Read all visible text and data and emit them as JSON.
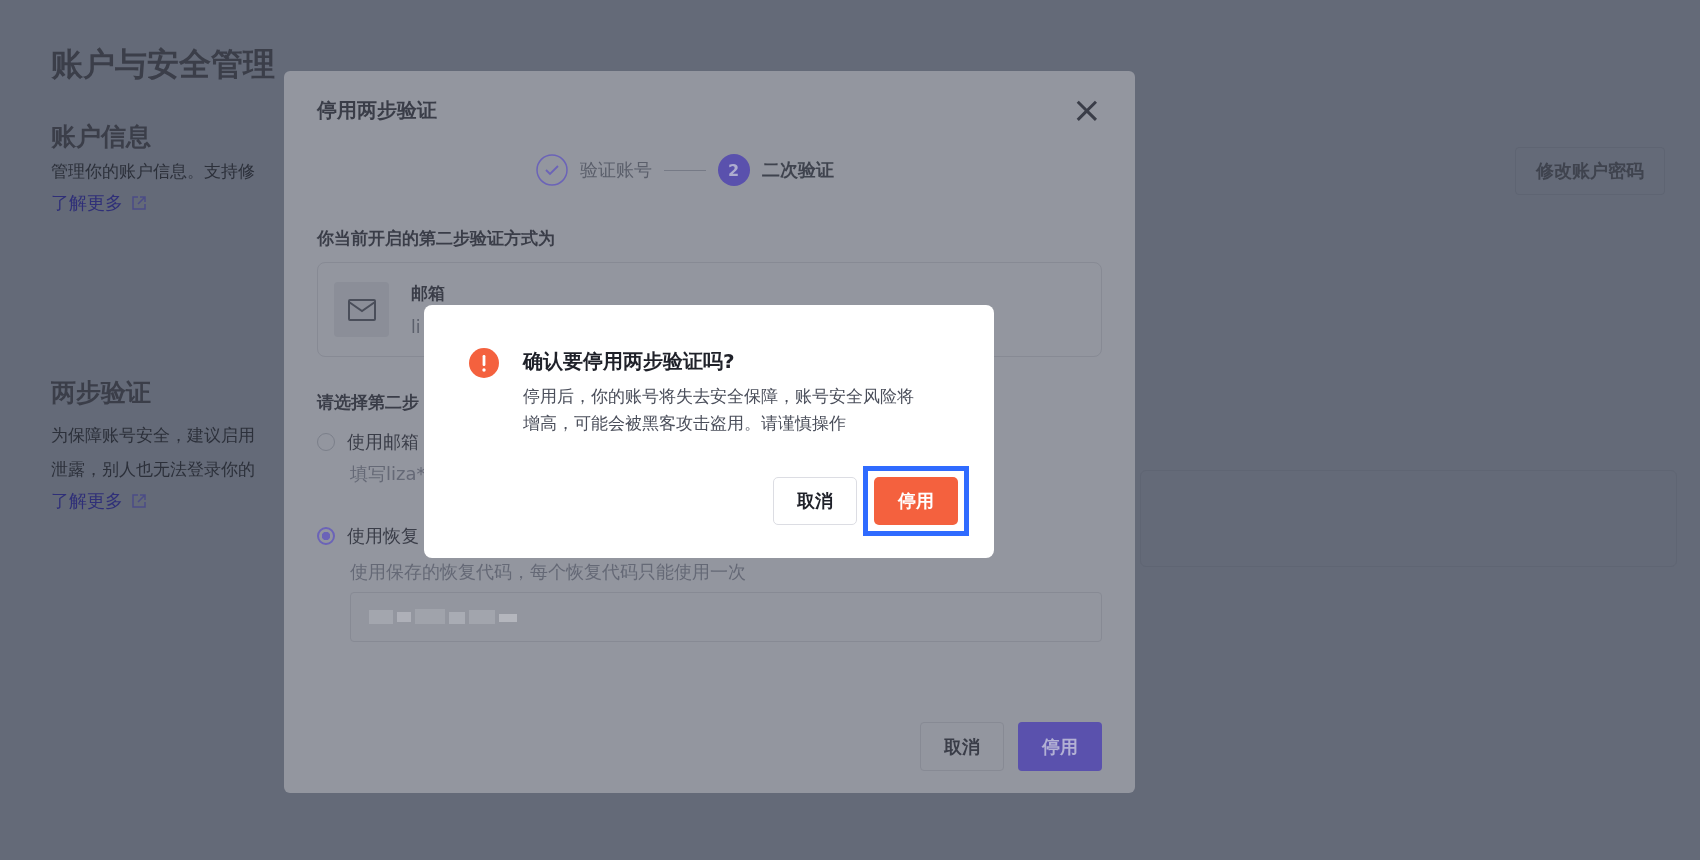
{
  "page": {
    "title": "账户与安全管理",
    "sections": [
      {
        "title": "账户信息",
        "lines": [
          "管理你的账户信息。支持修"
        ],
        "link": "了解更多",
        "action": "修改账户密码"
      },
      {
        "title": "两步验证",
        "lines": [
          "为保障账号安全，建议启用",
          "泄露，别人也无法登录你的"
        ],
        "link": "了解更多"
      }
    ]
  },
  "modal": {
    "title": "停用两步验证",
    "close": "×",
    "steps": [
      {
        "label": "验证账号",
        "completed": true
      },
      {
        "label": "二次验证",
        "completed": false,
        "number": "2"
      }
    ],
    "current_label": "你当前开启的第二步验证方式为",
    "method": {
      "name": "邮箱",
      "value": "li"
    },
    "choose_label": "请选择第二步",
    "options": [
      {
        "label": "使用邮箱",
        "hint": "填写liza*",
        "selected": false
      },
      {
        "label": "使用恢复",
        "hint": "使用保存的恢复代码，每个恢复代码只能使用一次",
        "selected": true,
        "code_redacted": true
      }
    ],
    "buttons": [
      {
        "label": "取消",
        "kind": "secondary"
      },
      {
        "label": "停用",
        "kind": "primary"
      }
    ]
  },
  "confirm": {
    "title": "确认要停用两步验证吗?",
    "message": "停用后，你的账号将失去安全保障，账号安全风险将增高，可能会被黑客攻击盗用。请谨慎操作",
    "buttons": [
      {
        "label": "取消",
        "kind": "secondary",
        "highlighted": false
      },
      {
        "label": "停用",
        "kind": "danger",
        "highlighted": true
      }
    ]
  }
}
